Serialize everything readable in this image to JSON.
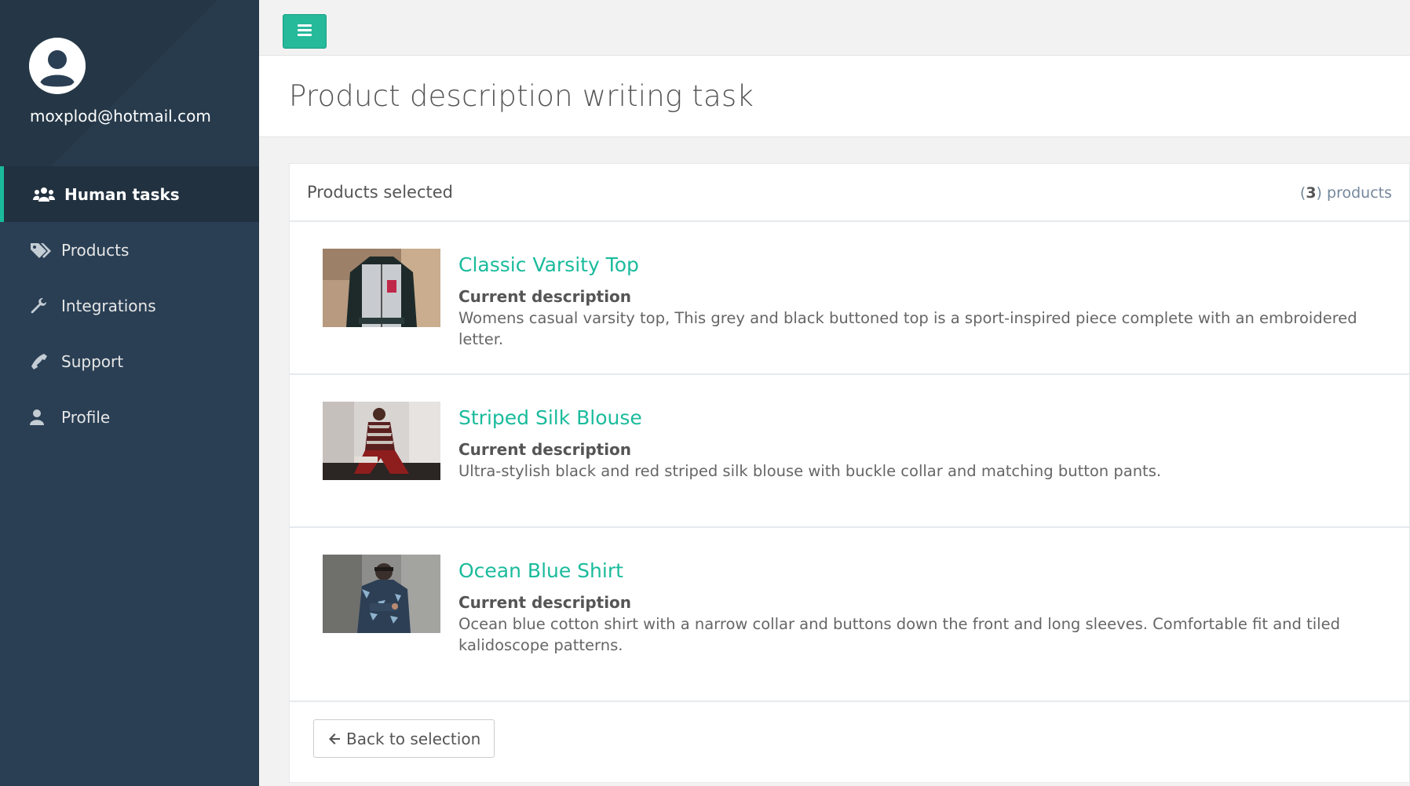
{
  "sidebar": {
    "user_email": "moxplod@hotmail.com",
    "items": [
      {
        "label": "Human tasks",
        "icon": "users-icon",
        "active": true
      },
      {
        "label": "Products",
        "icon": "tags-icon",
        "active": false
      },
      {
        "label": "Integrations",
        "icon": "wrench-icon",
        "active": false
      },
      {
        "label": "Support",
        "icon": "phone-icon",
        "active": false
      },
      {
        "label": "Profile",
        "icon": "user-icon",
        "active": false
      }
    ]
  },
  "topbar": {
    "menu_icon": "bars-icon"
  },
  "page": {
    "title": "Product description writing task"
  },
  "panel": {
    "title": "Products selected",
    "count_number": "3",
    "count_suffix": " products",
    "description_label": "Current description",
    "products": [
      {
        "name": "Classic Varsity Top",
        "description_label": "Current description",
        "description": "Womens casual varsity top, This grey and black buttoned top is a sport-inspired piece complete with an embroidered letter."
      },
      {
        "name": "Striped Silk Blouse",
        "description_label": "Current description",
        "description": "Ultra-stylish black and red striped silk blouse with buckle collar and matching button pants."
      },
      {
        "name": "Ocean Blue Shirt",
        "description_label": "Current description",
        "description": "Ocean blue cotton shirt with a narrow collar and buttons down the front and long sleeves. Comfortable fit and tiled kalidoscope patterns."
      }
    ],
    "back_button_label": "Back to selection"
  },
  "colors": {
    "sidebar_bg": "#2a3f54",
    "accent": "#1abb9c",
    "button_green": "#26b99a"
  }
}
